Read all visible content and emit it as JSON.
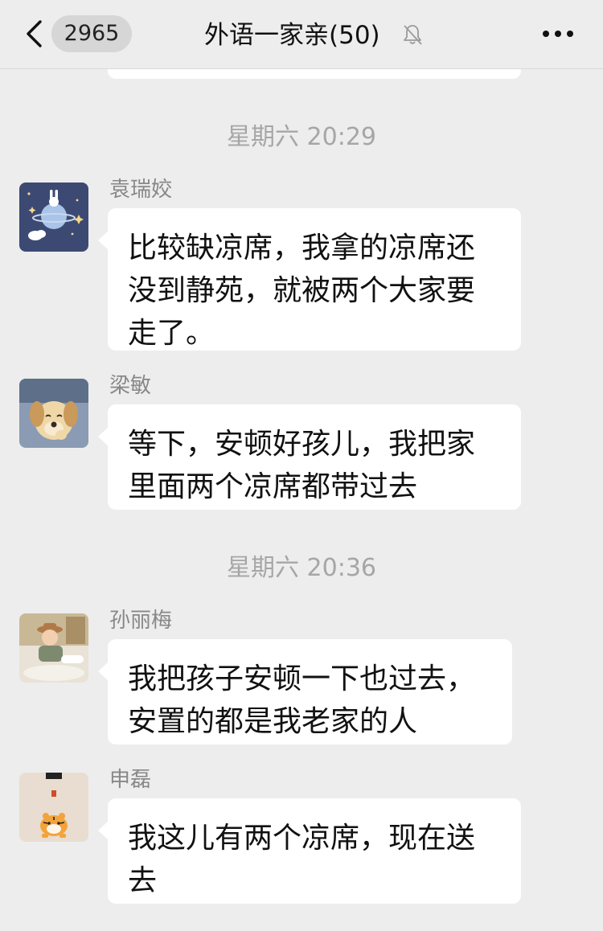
{
  "header": {
    "unread_count": "2965",
    "title": "外语一家亲(50)"
  },
  "messages": [
    {
      "timestamp": "星期六 20:29",
      "sender": "袁瑞姣",
      "text": "比较缺凉席，我拿的凉席还没到静苑，就被两个大家要走了。"
    },
    {
      "sender": "梁敏",
      "text": "等下，安顿好孩儿，我把家里面两个凉席都带过去"
    },
    {
      "timestamp": "星期六 20:36",
      "sender": "孙丽梅",
      "text": "我把孩子安顿一下也过去，安置的都是我老家的人"
    },
    {
      "sender": "申磊",
      "text": "我这儿有两个凉席，现在送去"
    }
  ],
  "colors": {
    "background": "#ededed",
    "bubble": "#ffffff",
    "timestamp_text": "#a6a6a6",
    "sender_text": "#888888"
  }
}
